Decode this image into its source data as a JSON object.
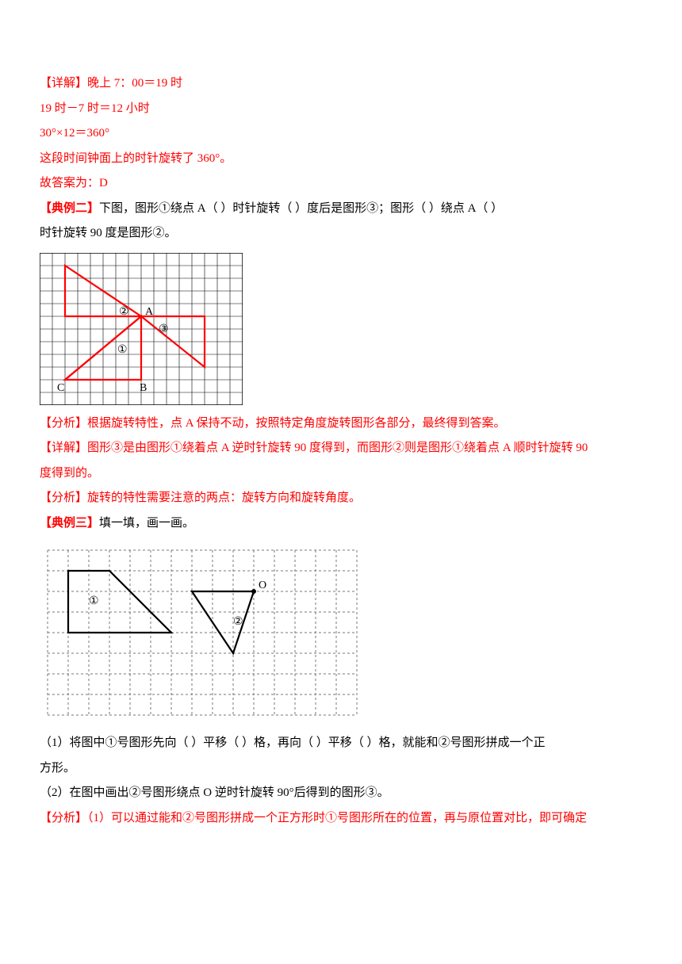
{
  "lines": {
    "l1": "【详解】晚上 7：00＝19 时",
    "l2": "19 时－7 时＝12 小时",
    "l3": "30°×12＝360°",
    "l4": "这段时间钟面上的时针旋转了 360°。",
    "l5": "故答案为：D",
    "ex2": {
      "tag": "【典例二】",
      "text1": "下图，图形①绕点 A（        ）时针旋转（        ）度后是图形③；图形（        ）绕点 A（        ）",
      "text2": "时针旋转 90 度是图形②。"
    },
    "fig1": {
      "labA": "A",
      "lab1": "①",
      "lab2": "②",
      "lab3": "③",
      "labB": "B",
      "labC": "C"
    },
    "an1": "【分析】根据旋转特性，点 A 保持不动，按照特定角度旋转图形各部分，最终得到答案。",
    "an2": "【详解】图形③是由图形①绕着点 A 逆时针旋转 90 度得到，而图形②则是图形①绕着点 A 顺时针旋转 90",
    "an2b": "度得到的。",
    "an3": "【分析】旋转的特性需要注意的两点：旋转方向和旋转角度。",
    "ex3": {
      "tag": "【典例三】",
      "text": "填一填，画一画。"
    },
    "fig2": {
      "lab1": "①",
      "lab2": "②",
      "labO": "O"
    },
    "q1": "（1）将图中①号图形先向（   ）平移（   ）格，再向（   ）平移（   ）格，就能和②号图形拼成一个正",
    "q1b": "方形。",
    "q2": "（2）在图中画出②号图形绕点 O 逆时针旋转 90°后得到的图形③。",
    "an4": "【分析】（1）可以通过能和②号图形拼成一个正方形时①号图形所在的位置，再与原位置对比，即可确定"
  }
}
